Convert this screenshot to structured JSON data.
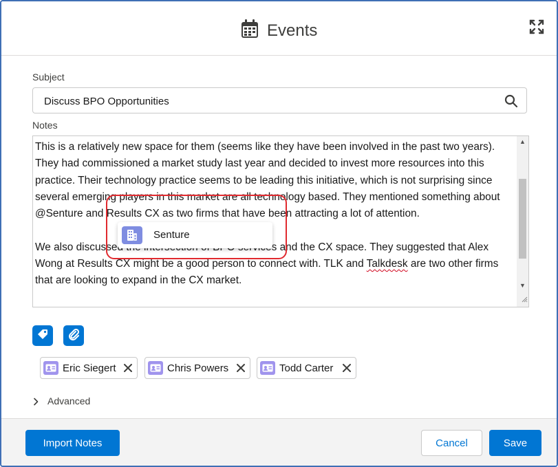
{
  "modal": {
    "title": "Events"
  },
  "subject": {
    "label": "Subject",
    "value": "Discuss BPO Opportunities"
  },
  "notes": {
    "label": "Notes",
    "paragraph1": "This is a relatively new space for them (seems like they have been involved in the past two years). They had commissioned a market study last year and decided to invest more resources into this practice. Their technology practice seems to be leading this initiative, which is not surprising since several emerging players in this market are all technology based. They mentioned something about @Senture and Results CX as two firms that have been attracting a lot of attention.",
    "paragraph2_before": "We also discussed the intersection of BPO services and the CX space. They suggested that Alex Wong at Results CX might be a good person to connect with. TLK and ",
    "paragraph2_flagged": "Talkdesk",
    "paragraph2_after": " are two other firms that are looking to expand in the CX market."
  },
  "mention_suggestion": {
    "label": "Senture"
  },
  "related_people": [
    {
      "name": "Eric Siegert"
    },
    {
      "name": "Chris Powers"
    },
    {
      "name": "Todd Carter"
    }
  ],
  "advanced": {
    "label": "Advanced"
  },
  "footer": {
    "import_label": "Import Notes",
    "cancel_label": "Cancel",
    "save_label": "Save"
  },
  "colors": {
    "brand": "#0176d3",
    "contact_icon": "#a094ed",
    "account_icon": "#7f8de1",
    "highlight": "#e0292e"
  }
}
